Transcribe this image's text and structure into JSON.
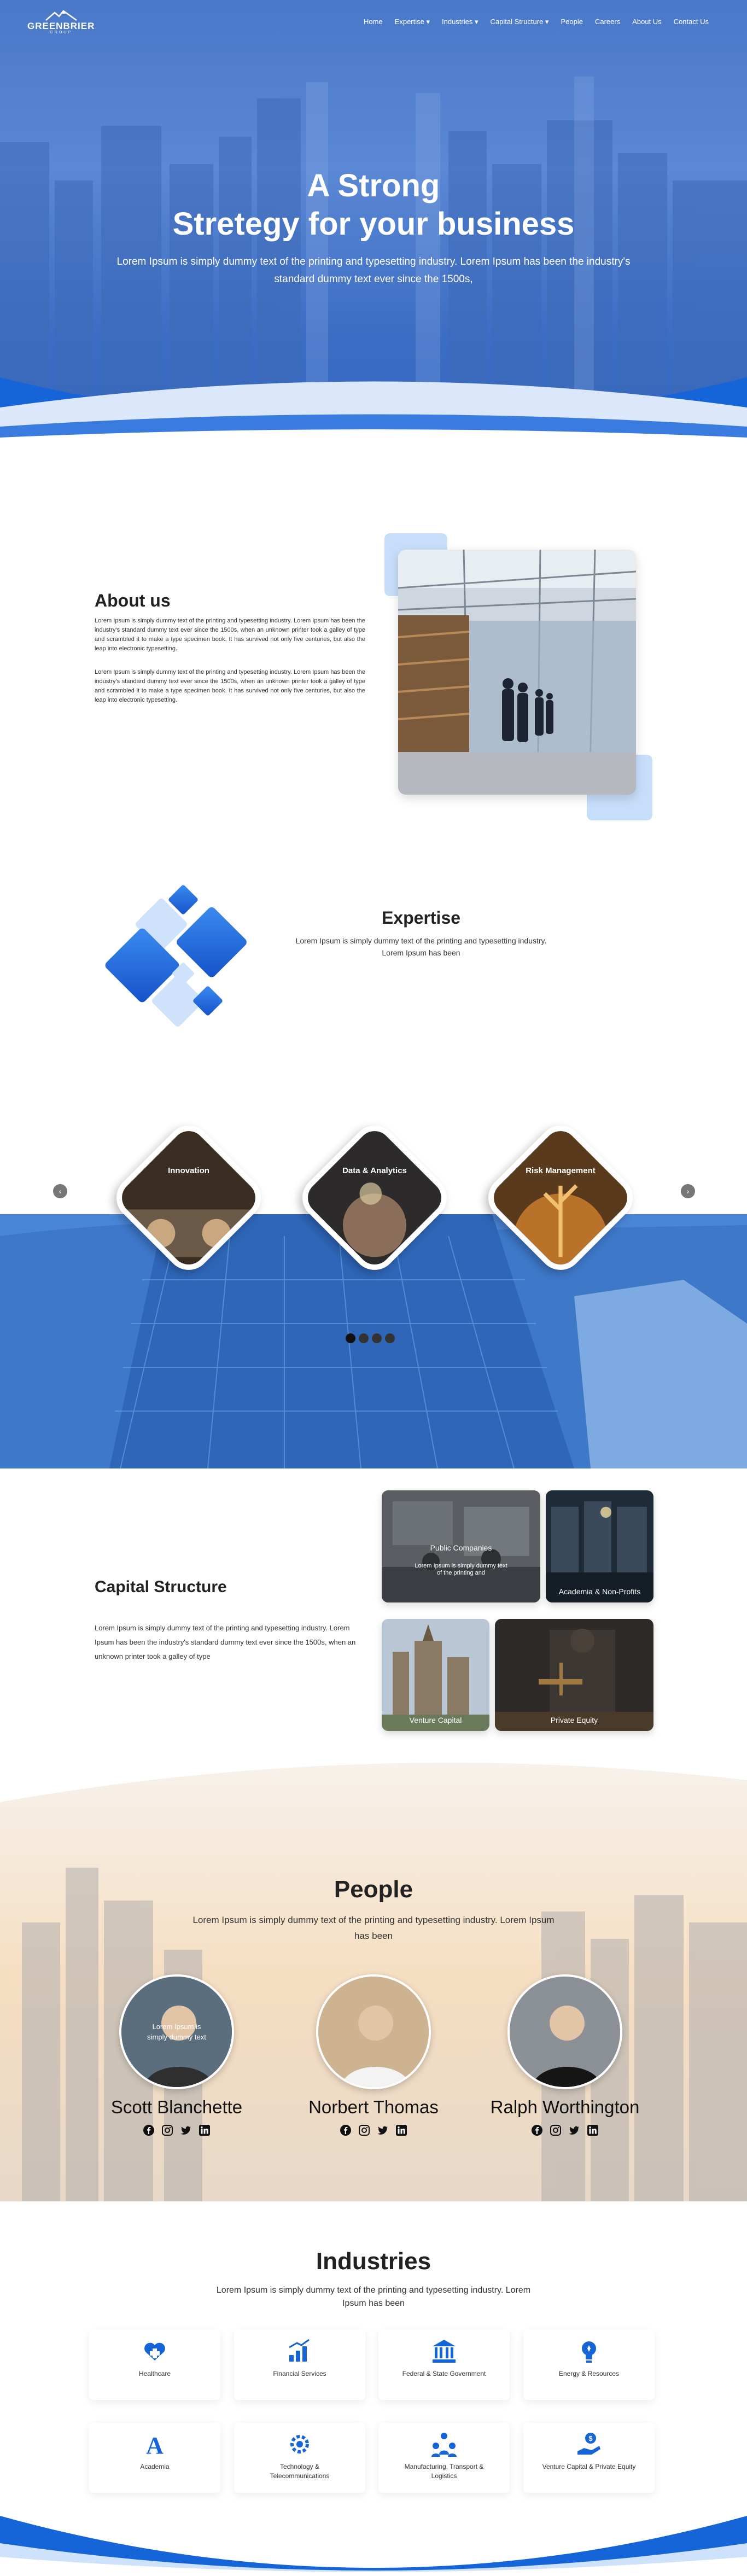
{
  "nav": {
    "brand": "GREENBRIER",
    "brand_sub": "GROUP",
    "items": [
      {
        "label": "Home",
        "name": "nav-home"
      },
      {
        "label": "Expertise ▾",
        "name": "nav-expertise"
      },
      {
        "label": "Industries ▾",
        "name": "nav-industries"
      },
      {
        "label": "Capital Structure ▾",
        "name": "nav-capital-structure"
      },
      {
        "label": "People",
        "name": "nav-people"
      },
      {
        "label": "Careers",
        "name": "nav-careers"
      },
      {
        "label": "About Us",
        "name": "nav-about-us"
      },
      {
        "label": "Contact Us",
        "name": "nav-contact-us"
      }
    ]
  },
  "hero": {
    "title_line1": "A Strong",
    "title_line2": "Stretegy for your business",
    "subtitle": "Lorem Ipsum is simply dummy text of the printing and typesetting industry. Lorem Ipsum has been the industry's standard dummy text ever since the 1500s,"
  },
  "about": {
    "title": "About us",
    "para1": "Lorem Ipsum is simply dummy text of the printing and typesetting industry. Lorem Ipsum has been the industry's standard dummy text ever since the 1500s, when an unknown printer took a galley of type and scrambled it to make a type specimen book. It has survived not only five centuries, but also the leap into electronic typesetting.",
    "para2": "Lorem Ipsum is simply dummy text of the printing and typesetting industry. Lorem Ipsum has been the industry's standard dummy text ever since the 1500s, when an unknown printer took a galley of type and scrambled it to make a type specimen book. It has survived not only five centuries, but also the leap into electronic typesetting."
  },
  "expertise": {
    "title": "Expertise",
    "text": "Lorem Ipsum is simply dummy text of the printing and typesetting industry. Lorem Ipsum has been"
  },
  "carousel": {
    "prev": "‹",
    "next": "›",
    "items": [
      {
        "label": "Innovation",
        "color": "#3a2e22"
      },
      {
        "label": "Data & Analytics",
        "color": "#2c2a2a"
      },
      {
        "label": "Risk Management",
        "color": "#5a3a1c"
      }
    ],
    "dots": 4,
    "active_dot": 0
  },
  "capital": {
    "title": "Capital Structure",
    "text": "Lorem Ipsum is simply dummy text of the printing and typesetting industry. Lorem Ipsum has been the industry's standard dummy text ever since the 1500s, when an unknown printer took a galley of type",
    "cards": [
      {
        "label": "Public Companies",
        "desc": "Lorem Ipsum is simply dummy text of the printing and"
      },
      {
        "label": "Academia & Non-Profits",
        "desc": ""
      },
      {
        "label": "Venture Capital",
        "desc": ""
      },
      {
        "label": "Private Equity",
        "desc": ""
      }
    ]
  },
  "people": {
    "title": "People",
    "text": "Lorem Ipsum is simply dummy text of the printing and typesetting industry. Lorem Ipsum has been",
    "members": [
      {
        "name": "Scott Blanchette",
        "overlay": "Lorem Ipsum is simply dummy text"
      },
      {
        "name": "Norbert Thomas",
        "overlay": ""
      },
      {
        "name": "Ralph Worthington",
        "overlay": ""
      }
    ],
    "socials": [
      "facebook-icon",
      "instagram-icon",
      "twitter-icon",
      "linkedin-icon"
    ]
  },
  "industries": {
    "title": "Industries",
    "text": "Lorem Ipsum is simply dummy text of the printing and typesetting industry. Lorem Ipsum has been",
    "items": [
      {
        "label": "Healthcare",
        "icon": "healthcare-icon"
      },
      {
        "label": "Financial Services",
        "icon": "financial-services-icon"
      },
      {
        "label": "Federal & State Government",
        "icon": "government-building-icon"
      },
      {
        "label": "Energy & Resources",
        "icon": "energy-bulb-icon"
      },
      {
        "label": "Academia",
        "icon": "academia-letter-a-icon"
      },
      {
        "label": "Technology & Telecommunications",
        "icon": "technology-gear-icon"
      },
      {
        "label": "Manufacturing, Transport & Logistics",
        "icon": "manufacturing-group-icon"
      },
      {
        "label": "Venture Capital & Private Equity",
        "icon": "venture-capital-hand-icon"
      }
    ]
  },
  "colors": {
    "primary": "#1565d8",
    "light": "#c7defa",
    "dark": "#111111"
  }
}
